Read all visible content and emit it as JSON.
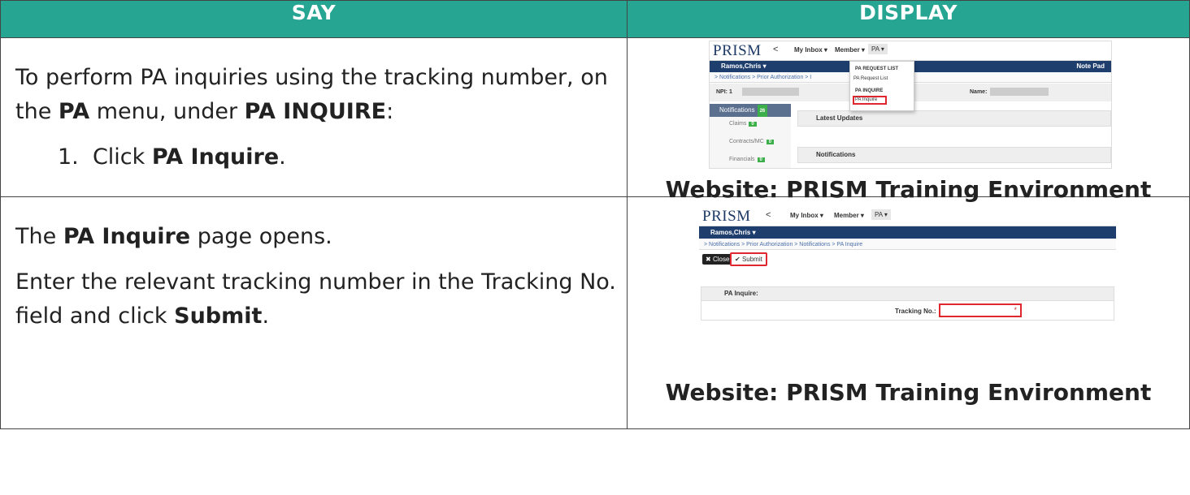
{
  "headers": {
    "say": "SAY",
    "display": "DISPLAY"
  },
  "rows": [
    {
      "say": {
        "p1_a": "To perform PA inquiries using the tracking number, on the ",
        "p1_b": "PA",
        "p1_c": " menu, under ",
        "p1_d": "PA INQUIRE",
        "p1_e": ":",
        "step_num": "1.",
        "step_a": "Click ",
        "step_b": "PA Inquire",
        "step_c": "."
      },
      "caption": "Website: PRISM Training Environment",
      "shot": {
        "logo": "PRISM",
        "chevron": "<",
        "menu_inbox": "My Inbox ▾",
        "menu_member": "Member ▾",
        "menu_pa": "PA ▾",
        "user": "Ramos,Chris ▾",
        "note_pad": "Note Pad",
        "crumb": "> Notifications > Prior Authorization > I",
        "npi_label": "NPI: 1",
        "name_label": "Name:",
        "notifications": "Notifications",
        "notifications_count": "26",
        "claims": "Claims",
        "claims_count": "0",
        "contracts": "Contracts/MC",
        "contracts_count": "0",
        "financials": "Financials",
        "financials_count": "0",
        "latest_updates": "Latest Updates",
        "notifications_panel": "Notifications",
        "dd_request_list_hdr": "PA REQUEST LIST",
        "dd_request_list": "PA Request List",
        "dd_inquire_hdr": "PA INQUIRE",
        "dd_inquire": "PA Inquire"
      }
    },
    {
      "say": {
        "p1_a": "The ",
        "p1_b": "PA Inquire",
        "p1_c": " page opens.",
        "p2_a": "Enter the relevant tracking number in the Tracking No. field and click ",
        "p2_b": "Submit",
        "p2_c": "."
      },
      "caption": "Website: PRISM Training Environment",
      "shot": {
        "logo": "PRISM",
        "chevron": "<",
        "menu_inbox": "My Inbox ▾",
        "menu_member": "Member ▾",
        "menu_pa": "PA ▾",
        "user": "Ramos,Chris ▾",
        "crumb": "> Notifications > Prior Authorization > Notifications > PA Inquire",
        "close": "Close",
        "submit": "Submit",
        "panel_title": "PA Inquire:",
        "tracking_label": "Tracking No.:",
        "required": "*"
      }
    }
  ],
  "colors": {
    "header_bg": "#26a593",
    "nav_blue": "#1e3f6e",
    "highlight_red": "#e0262f",
    "badge_green": "#3cae4a"
  }
}
